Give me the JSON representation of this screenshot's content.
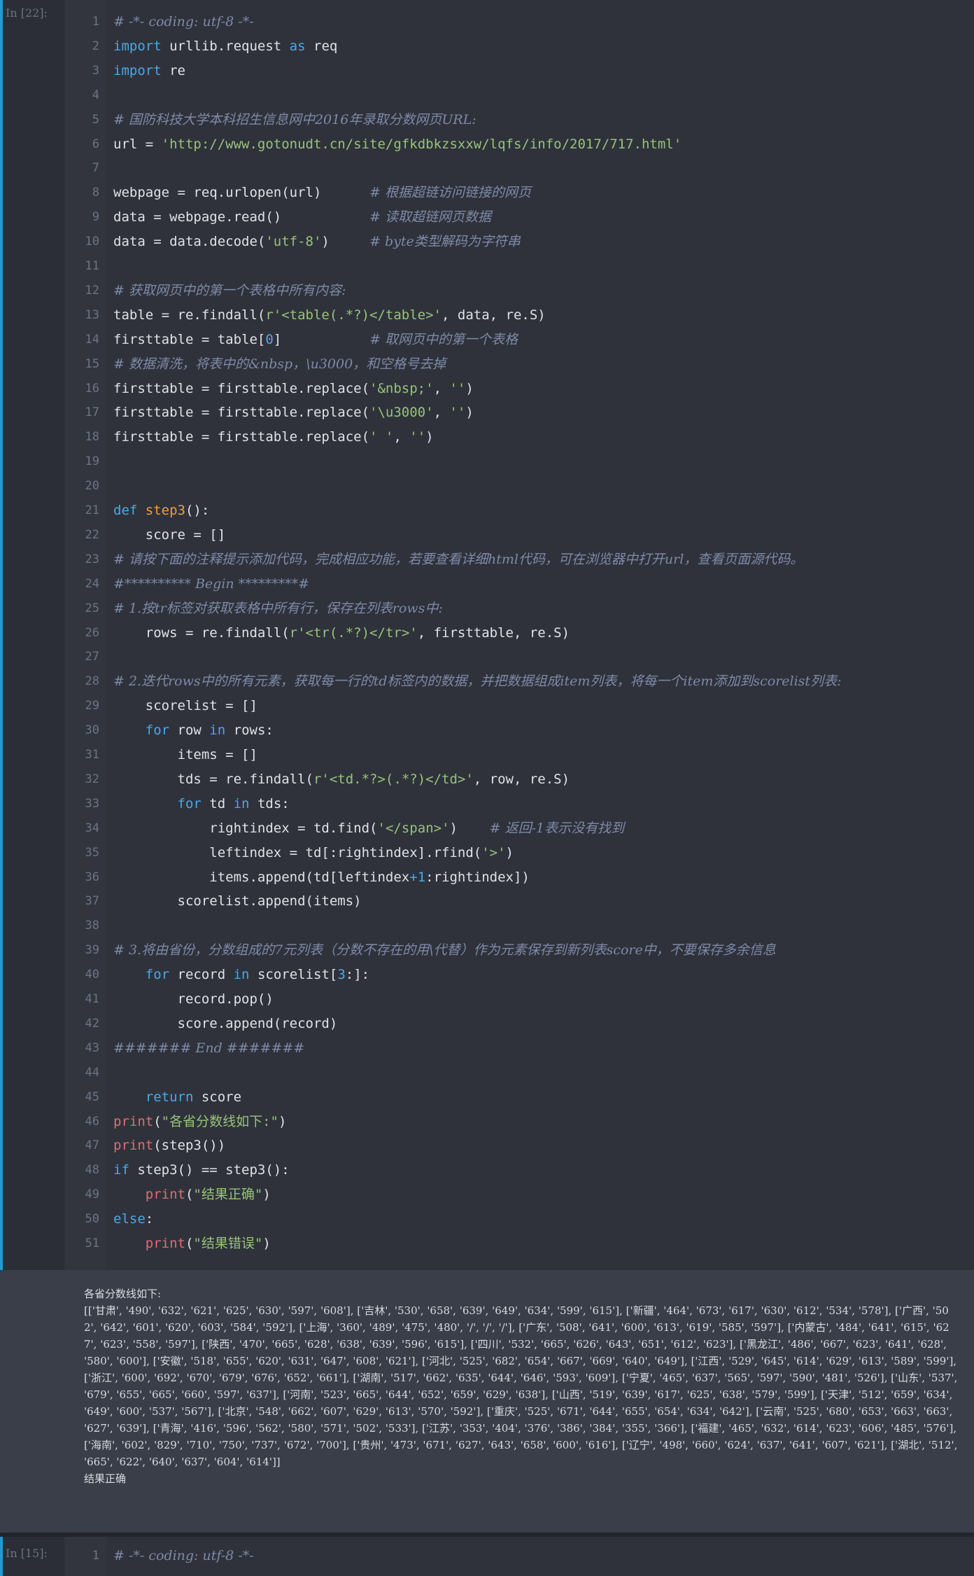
{
  "cell1": {
    "prompt": "In [22]:",
    "lines": [
      {
        "n": "1",
        "parts": [
          {
            "c": "cm",
            "t": "# -*- coding: utf-8 -*-"
          }
        ]
      },
      {
        "n": "2",
        "parts": [
          {
            "c": "kw",
            "t": "import"
          },
          {
            "c": "",
            "t": " urllib.request "
          },
          {
            "c": "kw",
            "t": "as"
          },
          {
            "c": "",
            "t": " req"
          }
        ]
      },
      {
        "n": "3",
        "parts": [
          {
            "c": "kw",
            "t": "import"
          },
          {
            "c": "",
            "t": " re"
          }
        ]
      },
      {
        "n": "4",
        "parts": []
      },
      {
        "n": "5",
        "parts": [
          {
            "c": "cm",
            "t": "# 国防科技大学本科招生信息网中2016年录取分数网页URL:"
          }
        ]
      },
      {
        "n": "6",
        "parts": [
          {
            "c": "",
            "t": "url = "
          },
          {
            "c": "st",
            "t": "'http://www.gotonudt.cn/site/gfkdbkzsxxw/lqfs/info/2017/717.html'"
          }
        ]
      },
      {
        "n": "7",
        "parts": []
      },
      {
        "n": "8",
        "parts": [
          {
            "c": "",
            "t": "webpage = req.urlopen(url)      "
          },
          {
            "c": "cm",
            "t": "# 根据超链访问链接的网页"
          }
        ]
      },
      {
        "n": "9",
        "parts": [
          {
            "c": "",
            "t": "data = webpage.read()           "
          },
          {
            "c": "cm",
            "t": "# 读取超链网页数据"
          }
        ]
      },
      {
        "n": "10",
        "parts": [
          {
            "c": "",
            "t": "data = data.decode("
          },
          {
            "c": "st",
            "t": "'utf-8'"
          },
          {
            "c": "",
            "t": ")     "
          },
          {
            "c": "cm",
            "t": "# byte类型解码为字符串"
          }
        ]
      },
      {
        "n": "11",
        "parts": []
      },
      {
        "n": "12",
        "parts": [
          {
            "c": "cm",
            "t": "# 获取网页中的第一个表格中所有内容:"
          }
        ]
      },
      {
        "n": "13",
        "parts": [
          {
            "c": "",
            "t": "table = re.findall("
          },
          {
            "c": "st",
            "t": "r'<table(.*?)</table>'"
          },
          {
            "c": "",
            "t": ", data, re.S)"
          }
        ]
      },
      {
        "n": "14",
        "parts": [
          {
            "c": "",
            "t": "firsttable = table["
          },
          {
            "c": "nm",
            "t": "0"
          },
          {
            "c": "",
            "t": "]           "
          },
          {
            "c": "cm",
            "t": "# 取网页中的第一个表格"
          }
        ]
      },
      {
        "n": "15",
        "parts": [
          {
            "c": "cm",
            "t": "# 数据清洗，将表中的&nbsp，\\u3000，和空格号去掉"
          }
        ]
      },
      {
        "n": "16",
        "parts": [
          {
            "c": "",
            "t": "firsttable = firsttable.replace("
          },
          {
            "c": "st",
            "t": "'&nbsp;'"
          },
          {
            "c": "",
            "t": ", "
          },
          {
            "c": "st",
            "t": "''"
          },
          {
            "c": "",
            "t": ")"
          }
        ]
      },
      {
        "n": "17",
        "parts": [
          {
            "c": "",
            "t": "firsttable = firsttable.replace("
          },
          {
            "c": "st",
            "t": "'\\u3000'"
          },
          {
            "c": "",
            "t": ", "
          },
          {
            "c": "st",
            "t": "''"
          },
          {
            "c": "",
            "t": ")"
          }
        ]
      },
      {
        "n": "18",
        "parts": [
          {
            "c": "",
            "t": "firsttable = firsttable.replace("
          },
          {
            "c": "st",
            "t": "' '"
          },
          {
            "c": "",
            "t": ", "
          },
          {
            "c": "st",
            "t": "''"
          },
          {
            "c": "",
            "t": ")"
          }
        ]
      },
      {
        "n": "19",
        "parts": []
      },
      {
        "n": "20",
        "parts": []
      },
      {
        "n": "21",
        "parts": [
          {
            "c": "kw",
            "t": "def"
          },
          {
            "c": "",
            "t": " "
          },
          {
            "c": "fn",
            "t": "step3"
          },
          {
            "c": "",
            "t": "():"
          }
        ]
      },
      {
        "n": "22",
        "parts": [
          {
            "c": "",
            "t": "    score = []"
          }
        ]
      },
      {
        "n": "23",
        "parts": [
          {
            "c": "cm",
            "t": "# 请按下面的注释提示添加代码，完成相应功能，若要查看详细html代码，可在浏览器中打开url，查看页面源代码。"
          }
        ]
      },
      {
        "n": "24",
        "parts": [
          {
            "c": "cm",
            "t": "#********** Begin *********#"
          }
        ]
      },
      {
        "n": "25",
        "parts": [
          {
            "c": "cm",
            "t": "# 1.按tr标签对获取表格中所有行，保存在列表rows中:"
          }
        ]
      },
      {
        "n": "26",
        "parts": [
          {
            "c": "",
            "t": "    rows = re.findall("
          },
          {
            "c": "st",
            "t": "r'<tr(.*?)</tr>'"
          },
          {
            "c": "",
            "t": ", firsttable, re.S)"
          }
        ]
      },
      {
        "n": "27",
        "parts": []
      },
      {
        "n": "28",
        "parts": [
          {
            "c": "cm",
            "t": "# 2.迭代rows中的所有元素，获取每一行的td标签内的数据，并把数据组成item列表，将每一个item添加到scorelist列表:"
          }
        ]
      },
      {
        "n": "29",
        "parts": [
          {
            "c": "",
            "t": "    scorelist = []"
          }
        ]
      },
      {
        "n": "30",
        "parts": [
          {
            "c": "",
            "t": "    "
          },
          {
            "c": "kw",
            "t": "for"
          },
          {
            "c": "",
            "t": " row "
          },
          {
            "c": "kw",
            "t": "in"
          },
          {
            "c": "",
            "t": " rows:"
          }
        ]
      },
      {
        "n": "31",
        "parts": [
          {
            "c": "",
            "t": "        items = []"
          }
        ]
      },
      {
        "n": "32",
        "parts": [
          {
            "c": "",
            "t": "        tds = re.findall("
          },
          {
            "c": "st",
            "t": "r'<td.*?>(.*?)</td>'"
          },
          {
            "c": "",
            "t": ", row, re.S)"
          }
        ]
      },
      {
        "n": "33",
        "parts": [
          {
            "c": "",
            "t": "        "
          },
          {
            "c": "kw",
            "t": "for"
          },
          {
            "c": "",
            "t": " td "
          },
          {
            "c": "kw",
            "t": "in"
          },
          {
            "c": "",
            "t": " tds:"
          }
        ]
      },
      {
        "n": "34",
        "parts": [
          {
            "c": "",
            "t": "            rightindex = td.find("
          },
          {
            "c": "st",
            "t": "'</span>'"
          },
          {
            "c": "",
            "t": ")    "
          },
          {
            "c": "cm",
            "t": "# 返回-1表示没有找到"
          }
        ]
      },
      {
        "n": "35",
        "parts": [
          {
            "c": "",
            "t": "            leftindex = td[:rightindex].rfind("
          },
          {
            "c": "st",
            "t": "'>'"
          },
          {
            "c": "",
            "t": ")"
          }
        ]
      },
      {
        "n": "36",
        "parts": [
          {
            "c": "",
            "t": "            items.append(td[leftindex"
          },
          {
            "c": "nm",
            "t": "+1"
          },
          {
            "c": "",
            "t": ":rightindex])"
          }
        ]
      },
      {
        "n": "37",
        "parts": [
          {
            "c": "",
            "t": "        scorelist.append(items)"
          }
        ]
      },
      {
        "n": "38",
        "parts": []
      },
      {
        "n": "39",
        "parts": [
          {
            "c": "cm",
            "t": "# 3.将由省份，分数组成的7元列表（分数不存在的用\\代替）作为元素保存到新列表score中，不要保存多余信息"
          }
        ]
      },
      {
        "n": "40",
        "parts": [
          {
            "c": "",
            "t": "    "
          },
          {
            "c": "kw",
            "t": "for"
          },
          {
            "c": "",
            "t": " record "
          },
          {
            "c": "kw",
            "t": "in"
          },
          {
            "c": "",
            "t": " scorelist["
          },
          {
            "c": "nm",
            "t": "3"
          },
          {
            "c": "",
            "t": ":]:"
          }
        ]
      },
      {
        "n": "41",
        "parts": [
          {
            "c": "",
            "t": "        record.pop()"
          }
        ]
      },
      {
        "n": "42",
        "parts": [
          {
            "c": "",
            "t": "        score.append(record)"
          }
        ]
      },
      {
        "n": "43",
        "parts": [
          {
            "c": "cm",
            "t": "####### End #######"
          }
        ]
      },
      {
        "n": "44",
        "parts": []
      },
      {
        "n": "45",
        "parts": [
          {
            "c": "",
            "t": "    "
          },
          {
            "c": "kw",
            "t": "return"
          },
          {
            "c": "",
            "t": " score"
          }
        ]
      },
      {
        "n": "46",
        "parts": [
          {
            "c": "pr",
            "t": "print"
          },
          {
            "c": "",
            "t": "("
          },
          {
            "c": "st",
            "t": "\"各省分数线如下:\""
          },
          {
            "c": "",
            "t": ")"
          }
        ]
      },
      {
        "n": "47",
        "parts": [
          {
            "c": "pr",
            "t": "print"
          },
          {
            "c": "",
            "t": "(step3())"
          }
        ]
      },
      {
        "n": "48",
        "parts": [
          {
            "c": "kw",
            "t": "if"
          },
          {
            "c": "",
            "t": " step3() == step3():"
          }
        ]
      },
      {
        "n": "49",
        "parts": [
          {
            "c": "",
            "t": "    "
          },
          {
            "c": "pr",
            "t": "print"
          },
          {
            "c": "",
            "t": "("
          },
          {
            "c": "st",
            "t": "\"结果正确\""
          },
          {
            "c": "",
            "t": ")"
          }
        ]
      },
      {
        "n": "50",
        "parts": [
          {
            "c": "kw",
            "t": "else"
          },
          {
            "c": "",
            "t": ":"
          }
        ]
      },
      {
        "n": "51",
        "parts": [
          {
            "c": "",
            "t": "    "
          },
          {
            "c": "pr",
            "t": "print"
          },
          {
            "c": "",
            "t": "("
          },
          {
            "c": "st",
            "t": "\"结果错误\""
          },
          {
            "c": "",
            "t": ")"
          }
        ]
      }
    ]
  },
  "output": {
    "text": "各省分数线如下:\n[['甘肃', '490', '632', '621', '625', '630', '597', '608'], ['吉林', '530', '658', '639', '649', '634', '599', '615'], ['新疆', '464', '673', '617', '630', '612', '534', '578'], ['广西', '502', '642', '601', '620', '603', '584', '592'], ['上海', '360', '489', '475', '480', '/', '/', '/'], ['广东', '508', '641', '600', '613', '619', '585', '597'], ['内蒙古', '484', '641', '615', '627', '623', '558', '597'], ['陕西', '470', '665', '628', '638', '639', '596', '615'], ['四川', '532', '665', '626', '643', '651', '612', '623'], ['黑龙江', '486', '667', '623', '641', '628', '580', '600'], ['安徽', '518', '655', '620', '631', '647', '608', '621'], ['河北', '525', '682', '654', '667', '669', '640', '649'], ['江西', '529', '645', '614', '629', '613', '589', '599'], ['浙江', '600', '692', '670', '679', '676', '652', '661'], ['湖南', '517', '662', '635', '644', '646', '593', '609'], ['宁夏', '465', '637', '565', '597', '590', '481', '526'], ['山东', '537', '679', '655', '665', '660', '597', '637'], ['河南', '523', '665', '644', '652', '659', '629', '638'], ['山西', '519', '639', '617', '625', '638', '579', '599'], ['天津', '512', '659', '634', '649', '600', '537', '567'], ['北京', '548', '662', '607', '629', '613', '570', '592'], ['重庆', '525', '671', '644', '655', '654', '634', '642'], ['云南', '525', '680', '653', '663', '663', '627', '639'], ['青海', '416', '596', '562', '580', '571', '502', '533'], ['江苏', '353', '404', '376', '386', '384', '355', '366'], ['福建', '465', '632', '614', '623', '606', '485', '576'], ['海南', '602', '829', '710', '750', '737', '672', '700'], ['贵州', '473', '671', '627', '643', '658', '600', '616'], ['辽宁', '498', '660', '624', '637', '641', '607', '621'], ['湖北', '512', '665', '622', '640', '637', '604', '614']]\n结果正确"
  },
  "cell2": {
    "prompt": "In [15]:",
    "lines": [
      {
        "n": "1",
        "parts": [
          {
            "c": "cm",
            "t": "# -*- coding: utf-8 -*-"
          }
        ]
      }
    ]
  },
  "colors": {
    "accent_bar": "#1e9bd7",
    "background": "#2b2e37",
    "keyword": "#4aa8e8",
    "string": "#98c379",
    "comment": "#7f8aa8"
  }
}
